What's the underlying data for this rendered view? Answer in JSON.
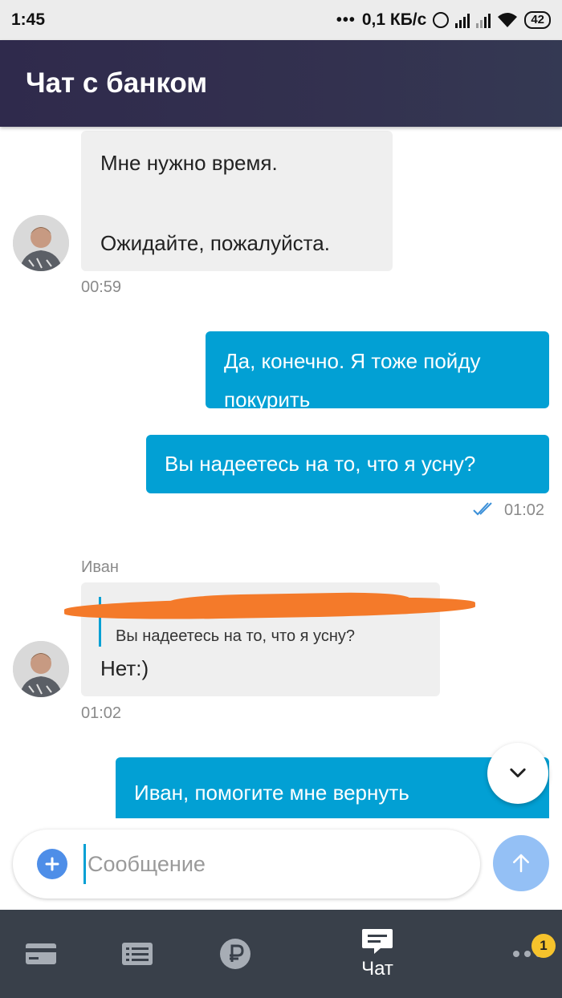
{
  "status_bar": {
    "time": "1:45",
    "dots": "•••",
    "speed": "0,1 КБ/с",
    "battery": "42"
  },
  "header": {
    "title": "Чат с банком"
  },
  "messages": [
    {
      "direction": "in",
      "line1": "Мне нужно время.",
      "line2": "Ожидайте, пожалуйста.",
      "time": "00:59"
    },
    {
      "direction": "out",
      "text": "Да, конечно. Я тоже пойду покурить"
    },
    {
      "direction": "out",
      "text": "Вы надеетесь на то, что я усну?",
      "time": "01:02"
    },
    {
      "direction": "in",
      "sender": "Иван",
      "quote_author_tail": "а",
      "quote_text": "Вы надеетесь на то, что я усну?",
      "text": "Нет:)",
      "time": "01:02"
    },
    {
      "direction": "out",
      "text": "Иван, помогите мне вернуть"
    }
  ],
  "composer": {
    "placeholder": "Сообщение"
  },
  "bottom_nav": {
    "chat_label": "Чат",
    "badge_count": "1"
  },
  "colors": {
    "accent": "#02a0d4",
    "header": "#2f2a4c",
    "nav": "#39404a",
    "badge": "#f6c32c"
  }
}
